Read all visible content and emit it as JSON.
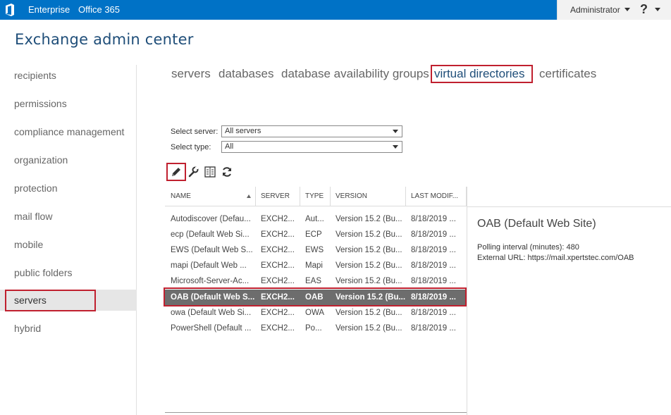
{
  "topbar": {
    "links": [
      "Enterprise",
      "Office 365"
    ],
    "user": "Administrator",
    "help": "?",
    "brand_color": "#0072c6"
  },
  "app_title": "Exchange admin center",
  "sidebar": {
    "items": [
      {
        "label": "recipients"
      },
      {
        "label": "permissions"
      },
      {
        "label": "compliance management"
      },
      {
        "label": "organization"
      },
      {
        "label": "protection"
      },
      {
        "label": "mail flow"
      },
      {
        "label": "mobile"
      },
      {
        "label": "public folders"
      },
      {
        "label": "servers",
        "active": true
      },
      {
        "label": "hybrid"
      }
    ]
  },
  "tabs": [
    {
      "label": "servers"
    },
    {
      "label": "databases"
    },
    {
      "label": "database availability groups"
    },
    {
      "label": "virtual directories",
      "active": true
    },
    {
      "label": "certificates"
    }
  ],
  "filters": {
    "server_label": "Select server:",
    "server_value": "All servers",
    "type_label": "Select type:",
    "type_value": "All"
  },
  "toolbar": {
    "icons": [
      "edit-pencil-icon",
      "wrench-icon",
      "properties-list-icon",
      "refresh-icon"
    ]
  },
  "table": {
    "columns": [
      "NAME",
      "SERVER",
      "TYPE",
      "VERSION",
      "LAST MODIF..."
    ],
    "rows": [
      [
        "Autodiscover (Defau...",
        "EXCH2...",
        "Aut...",
        "Version 15.2 (Bu...",
        "8/18/2019 ..."
      ],
      [
        "ecp (Default Web Si...",
        "EXCH2...",
        "ECP",
        "Version 15.2 (Bu...",
        "8/18/2019 ..."
      ],
      [
        "EWS (Default Web S...",
        "EXCH2...",
        "EWS",
        "Version 15.2 (Bu...",
        "8/18/2019 ..."
      ],
      [
        "mapi (Default Web ...",
        "EXCH2...",
        "Mapi",
        "Version 15.2 (Bu...",
        "8/18/2019 ..."
      ],
      [
        "Microsoft-Server-Ac...",
        "EXCH2...",
        "EAS",
        "Version 15.2 (Bu...",
        "8/18/2019 ..."
      ],
      [
        "OAB (Default Web S...",
        "EXCH2...",
        "OAB",
        "Version 15.2 (Bu...",
        "8/18/2019 ..."
      ],
      [
        "owa (Default Web Si...",
        "EXCH2...",
        "OWA",
        "Version 15.2 (Bu...",
        "8/18/2019 ..."
      ],
      [
        "PowerShell (Default ...",
        "EXCH2...",
        "Po...",
        "Version 15.2 (Bu...",
        "8/18/2019 ..."
      ]
    ],
    "selected_index": 5
  },
  "details": {
    "title": "OAB (Default Web Site)",
    "lines": [
      "Polling interval (minutes): 480",
      "External URL: https://mail.xpertstec.com/OAB"
    ]
  },
  "highlight_color": "#c0202f"
}
